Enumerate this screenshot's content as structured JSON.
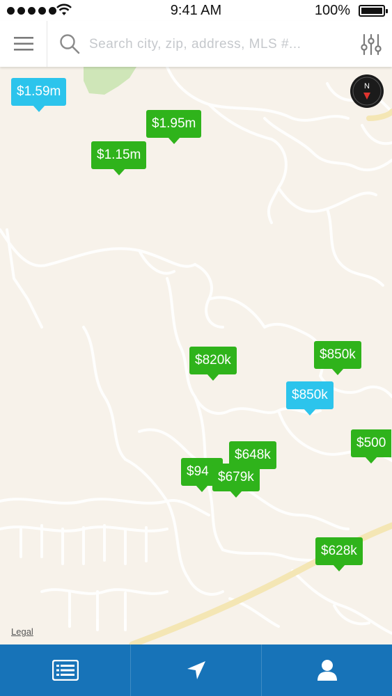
{
  "status_bar": {
    "time": "9:41 AM",
    "battery": "100%"
  },
  "search": {
    "placeholder": "Search city, zip, address, MLS #..."
  },
  "map": {
    "legal_label": "Legal",
    "pins": [
      {
        "id": "pin-1-59m",
        "label": "$1.59m",
        "color": "blue"
      },
      {
        "id": "pin-1-95m",
        "label": "$1.95m",
        "color": "green"
      },
      {
        "id": "pin-1-15m",
        "label": "$1.15m",
        "color": "green"
      },
      {
        "id": "pin-820k",
        "label": "$820k",
        "color": "green"
      },
      {
        "id": "pin-850k-green",
        "label": "$850k",
        "color": "green"
      },
      {
        "id": "pin-850k-blue",
        "label": "$850k",
        "color": "blue"
      },
      {
        "id": "pin-500",
        "label": "$500",
        "color": "green"
      },
      {
        "id": "pin-648k",
        "label": "$648k",
        "color": "green"
      },
      {
        "id": "pin-94",
        "label": "$94",
        "color": "green"
      },
      {
        "id": "pin-679k",
        "label": "$679k",
        "color": "green"
      },
      {
        "id": "pin-628k",
        "label": "$628k",
        "color": "green"
      }
    ]
  },
  "tabs": [
    {
      "icon": "list-icon"
    },
    {
      "icon": "navigation-arrow-icon"
    },
    {
      "icon": "person-icon"
    }
  ],
  "colors": {
    "pin_green": "#2fb31b",
    "pin_blue": "#2cc4ec",
    "tab_bar": "#1773b8",
    "map_background": "#f7f2ea"
  }
}
